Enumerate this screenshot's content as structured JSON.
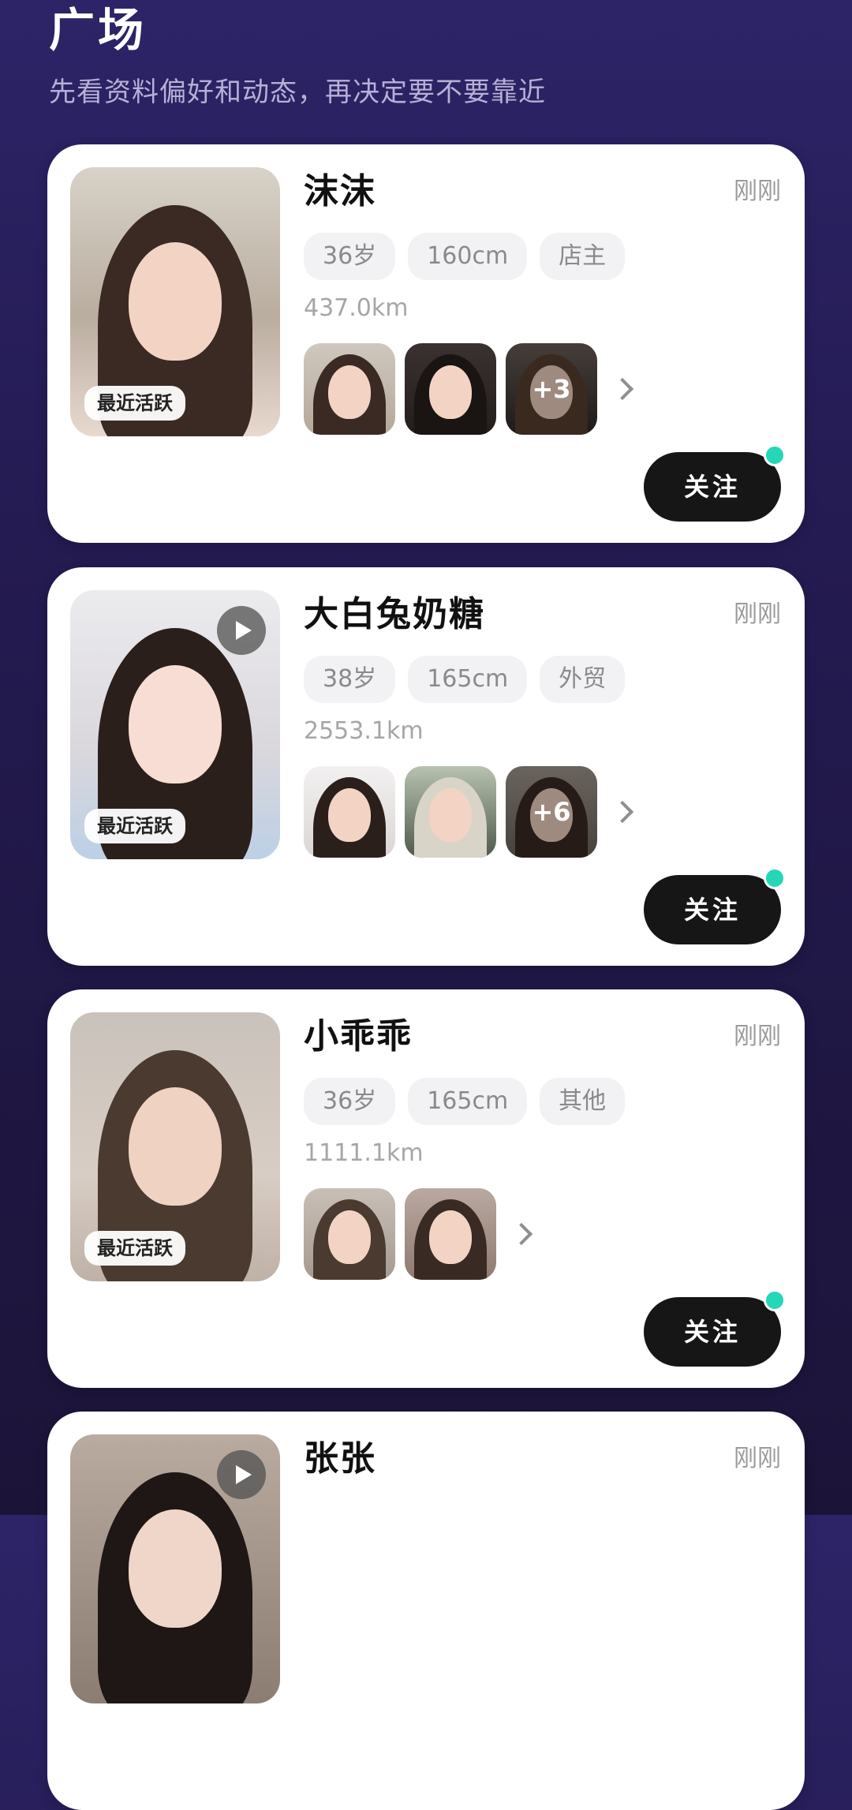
{
  "header": {
    "title": "广场",
    "subtitle": "先看资料偏好和动态，再决定要不要靠近"
  },
  "cards": [
    {
      "name": "沫沫",
      "time": "刚刚",
      "tags": [
        "36岁",
        "160cm",
        "店主"
      ],
      "distance": "437.0km",
      "active_badge": "最近活跃",
      "more_count": "+3",
      "follow_label": "关注",
      "has_video": false
    },
    {
      "name": "大白兔奶糖",
      "time": "刚刚",
      "tags": [
        "38岁",
        "165cm",
        "外贸"
      ],
      "distance": "2553.1km",
      "active_badge": "最近活跃",
      "more_count": "+6",
      "follow_label": "关注",
      "has_video": true
    },
    {
      "name": "小乖乖",
      "time": "刚刚",
      "tags": [
        "36岁",
        "165cm",
        "其他"
      ],
      "distance": "1111.1km",
      "active_badge": "最近活跃",
      "more_count": "",
      "follow_label": "关注",
      "has_video": false
    },
    {
      "name": "张张",
      "time": "刚刚",
      "tags": [],
      "distance": "",
      "active_badge": "",
      "more_count": "",
      "follow_label": "",
      "has_video": true
    }
  ],
  "colors": {
    "background": "#241b52",
    "card": "#ffffff",
    "follow_button": "#161616",
    "online_dot": "#23d7b7",
    "tag_bg": "#f2f2f4"
  },
  "icons": {
    "video": "play-icon",
    "more": "chevron-right-icon",
    "online": "online-dot-icon"
  }
}
